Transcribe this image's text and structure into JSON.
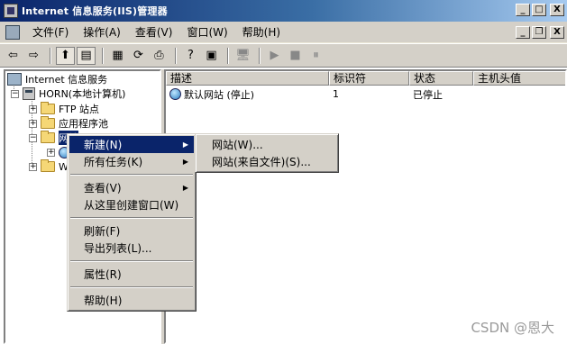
{
  "window": {
    "title": "Internet 信息服务(IIS)管理器",
    "buttons": {
      "minimize": "_",
      "maximize": "□",
      "close": "X"
    }
  },
  "menubar": {
    "items": [
      "文件(F)",
      "操作(A)",
      "查看(V)",
      "窗口(W)",
      "帮助(H)"
    ],
    "inner_buttons": {
      "minimize": "_",
      "restore": "❐",
      "close": "X"
    }
  },
  "toolbar": {
    "back": "⇦",
    "forward": "⇨",
    "up": "⬆",
    "tree": "▤",
    "props": "▦",
    "refresh": "⟳",
    "export": "⎙",
    "help": "?",
    "console": "▣",
    "computer": "🖥",
    "play": "▶",
    "stop": "■",
    "pause": "⏸"
  },
  "tree": {
    "root": "Internet 信息服务",
    "server": "HORN(本地计算机)",
    "ftp": "FTP 站点",
    "apppool": "应用程序池",
    "websites_partial": "网站",
    "web_ext_partial": "W",
    "expand_minus": "−",
    "expand_plus": "+"
  },
  "list": {
    "columns": [
      "描述",
      "标识符",
      "状态",
      "主机头值"
    ],
    "rows": [
      {
        "description": "默认网站 (停止)",
        "id": "1",
        "status": "已停止",
        "host": ""
      }
    ]
  },
  "context_menu": {
    "items": [
      "新建(N)",
      "所有任务(K)",
      "查看(V)",
      "从这里创建窗口(W)",
      "刷新(F)",
      "导出列表(L)...",
      "属性(R)",
      "帮助(H)"
    ]
  },
  "submenu": {
    "items": [
      "网站(W)...",
      "网站(来自文件)(S)..."
    ]
  },
  "watermark": "CSDN @恩大"
}
